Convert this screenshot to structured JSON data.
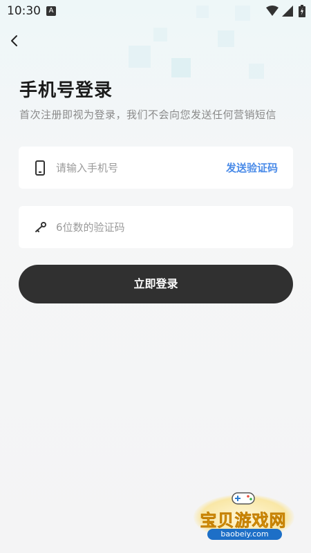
{
  "status_bar": {
    "time": "10:30",
    "notification_icon": "A"
  },
  "header": {
    "title": "手机号登录",
    "subtitle": "首次注册即视为登录，我们不会向您发送任何营销短信"
  },
  "form": {
    "phone": {
      "placeholder": "请输入手机号",
      "value": ""
    },
    "send_code_label": "发送验证码",
    "code": {
      "placeholder": "6位数的验证码",
      "value": ""
    },
    "submit_label": "立即登录"
  },
  "icons": [
    "back-arrow-icon",
    "phone-icon",
    "key-icon",
    "wifi-icon",
    "signal-icon",
    "battery-icon"
  ],
  "colors": {
    "accent": "#4a8be8",
    "button": "#303030",
    "background": "#f4f4f5"
  },
  "watermark": {
    "text": "宝贝游戏网",
    "url": "baobeiy.com"
  }
}
